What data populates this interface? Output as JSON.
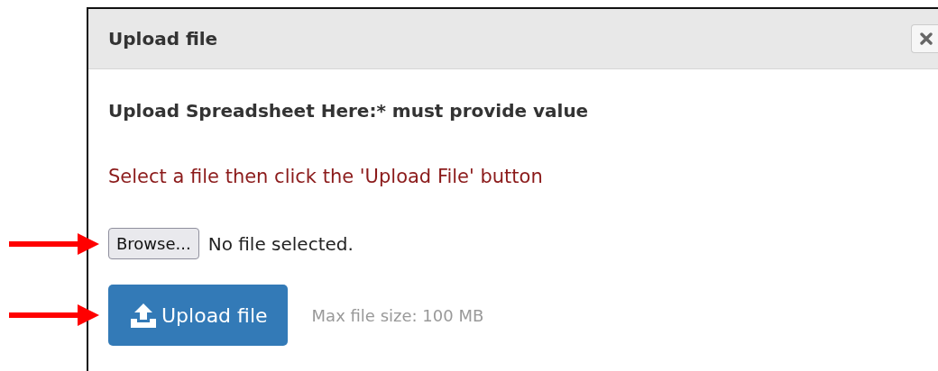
{
  "dialog": {
    "title": "Upload file",
    "field_label": "Upload Spreadsheet Here:* must provide value",
    "instruction": "Select a file then click the 'Upload File' button",
    "browse_button": "Browse...",
    "file_status": "No file selected.",
    "upload_button": "Upload file",
    "size_hint": "Max file size: 100 MB"
  }
}
